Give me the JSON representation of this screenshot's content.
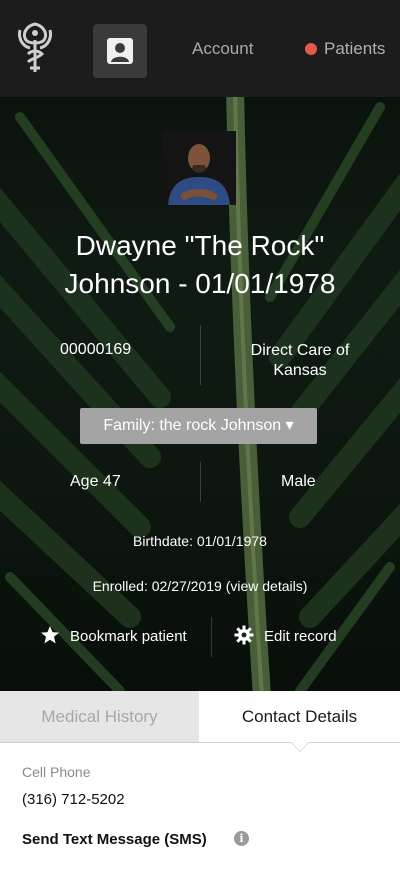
{
  "nav": {
    "account_label": "Account",
    "patients_label": "Patients",
    "patients_dot_color": "#e35a4c",
    "logo_icon": "caduceus-figure-logo",
    "avatar_icon": "user-avatar-icon"
  },
  "patient": {
    "name_line": "Dwayne \"The Rock\" Johnson - 01/01/1978",
    "id": "00000169",
    "organization": "Direct Care of Kansas",
    "family_select": "Family: the rock Johnson ▾",
    "age": "Age 47",
    "sex": "Male",
    "birthdate": "Birthdate: 01/01/1978",
    "enrolled": "Enrolled: 02/27/2019 (view details)"
  },
  "actions": {
    "bookmark_label": "Bookmark patient",
    "edit_label": "Edit record"
  },
  "tabs": {
    "medical_history": "Medical History",
    "contact_details": "Contact Details",
    "active": "contact_details"
  },
  "contact": {
    "cell_phone_label": "Cell Phone",
    "cell_phone_value": "(316) 712-5202",
    "sms_label": "Send Text Message (SMS)",
    "sms_info_icon": "i"
  }
}
